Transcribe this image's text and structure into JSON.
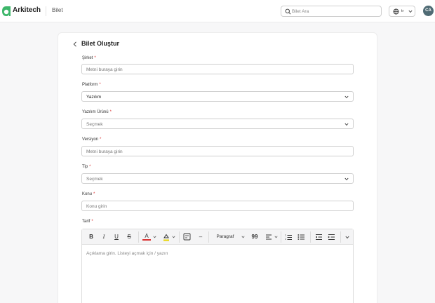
{
  "header": {
    "brand": "Arkitech",
    "breadcrumb": "Bilet",
    "search_placeholder": "Bilet Ara",
    "language_code": "tr",
    "avatar_initials": "CA",
    "accent_color": "#3db66a"
  },
  "form": {
    "title": "Bilet Oluştur",
    "required_mark": "*",
    "company": {
      "label": "Şirket",
      "placeholder": "Metni buraya girin"
    },
    "platform": {
      "label": "Platform",
      "value": "Yazılım"
    },
    "software_product": {
      "label": "Yazılım Ürünü",
      "value": "Seçmek"
    },
    "version": {
      "label": "Versiyon",
      "placeholder": "Metni buraya girin"
    },
    "type": {
      "label": "Tip",
      "value": "Seçmek"
    },
    "subject": {
      "label": "Konu",
      "placeholder": "Konu girin"
    },
    "description": {
      "label": "Tarif",
      "placeholder": "Açıklama girin. Listeyi açmak için / yazın",
      "toolbar": {
        "bold": "B",
        "italic": "I",
        "underline": "U",
        "strike": "S",
        "font_color": "A",
        "divider": "–",
        "paragraph": "Paragraf",
        "quote": "99"
      }
    }
  }
}
